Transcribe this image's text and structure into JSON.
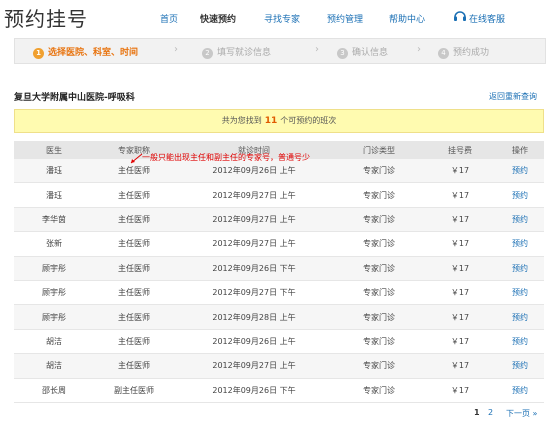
{
  "header": {
    "title": "预约挂号",
    "nav": [
      "首页",
      "快速预约",
      "寻找专家",
      "预约管理",
      "帮助中心"
    ],
    "service_label": "在线客服",
    "service_icon": "headset-icon"
  },
  "steps": [
    {
      "num": "1",
      "label": "选择医院、科室、时间"
    },
    {
      "num": "2",
      "label": "填写就诊信息"
    },
    {
      "num": "3",
      "label": "确认信息"
    },
    {
      "num": "4",
      "label": "预约成功"
    }
  ],
  "hospital": "复旦大学附属中山医院-呼吸科",
  "back_link": "返回重新查询",
  "banner": {
    "prefix": "共为您找到",
    "count": "11",
    "suffix": "个可预约的班次"
  },
  "annotation": "一般只能出现主任和副主任的专家号，普通号少",
  "table": {
    "headers": [
      "医生",
      "专家职称",
      "就诊时间",
      "门诊类型",
      "挂号费",
      "操作"
    ],
    "rows": [
      [
        "潘珏",
        "主任医师",
        "2012年09月26日 上午",
        "专家门诊",
        "￥17",
        "预约"
      ],
      [
        "潘珏",
        "主任医师",
        "2012年09月27日 上午",
        "专家门诊",
        "￥17",
        "预约"
      ],
      [
        "李华茵",
        "主任医师",
        "2012年09月27日 上午",
        "专家门诊",
        "￥17",
        "预约"
      ],
      [
        "张新",
        "主任医师",
        "2012年09月27日 上午",
        "专家门诊",
        "￥17",
        "预约"
      ],
      [
        "顾宇彤",
        "主任医师",
        "2012年09月26日 下午",
        "专家门诊",
        "￥17",
        "预约"
      ],
      [
        "顾宇彤",
        "主任医师",
        "2012年09月27日 下午",
        "专家门诊",
        "￥17",
        "预约"
      ],
      [
        "顾宇彤",
        "主任医师",
        "2012年09月28日 上午",
        "专家门诊",
        "￥17",
        "预约"
      ],
      [
        "胡洁",
        "主任医师",
        "2012年09月26日 上午",
        "专家门诊",
        "￥17",
        "预约"
      ],
      [
        "胡洁",
        "主任医师",
        "2012年09月27日 上午",
        "专家门诊",
        "￥17",
        "预约"
      ],
      [
        "邵长周",
        "副主任医师",
        "2012年09月26日 下午",
        "专家门诊",
        "￥17",
        "预约"
      ]
    ]
  },
  "pager": {
    "current": "1",
    "page2": "2",
    "next": "下一页 »"
  },
  "colors": {
    "accent": "#1a6fb4",
    "active_step": "#e8730e",
    "banner_bg": "#fffbb0",
    "count": "#e05a00",
    "annotation": "#e00000"
  }
}
